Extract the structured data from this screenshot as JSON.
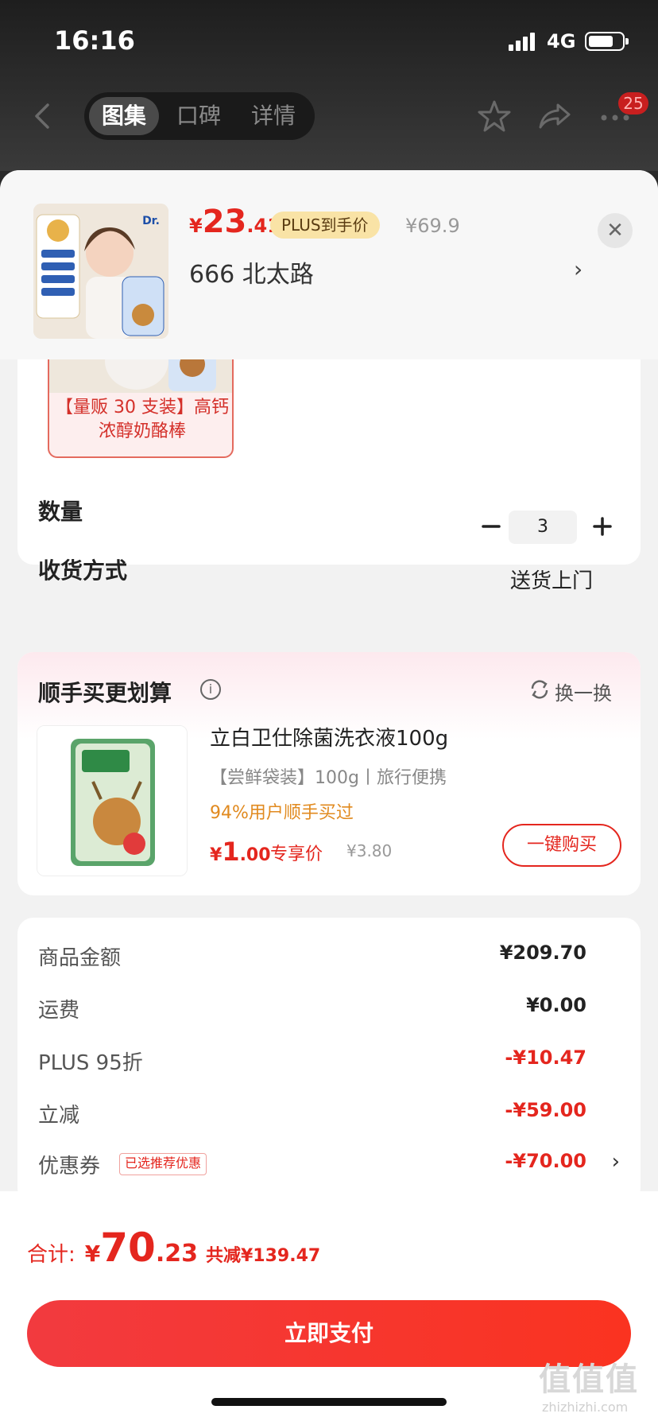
{
  "status": {
    "time": "16:16",
    "network": "4G"
  },
  "nav": {
    "tabs": [
      {
        "label": "图集",
        "active": true
      },
      {
        "label": "口碑",
        "active": false
      },
      {
        "label": "详情",
        "active": false
      }
    ],
    "badge": "25"
  },
  "header": {
    "price_currency": "¥",
    "price_int": "23",
    "price_dec": ".41",
    "plus_tag": "PLUS到手价",
    "orig_price": "¥69.9",
    "address": "666  北太路",
    "close_icon": "close-icon"
  },
  "product": {
    "sku_label": "【量贩 30 支装】高钙浓醇奶酪棒",
    "qty_label": "数量",
    "qty_value": "3",
    "delivery_label": "收货方式",
    "delivery_value": "送货上门"
  },
  "addon": {
    "title": "顺手买更划算",
    "swap_label": "换一换",
    "name": "立白卫仕除菌洗衣液100g",
    "subtitle": "【尝鲜袋装】100g丨旅行便携",
    "stat": "94%用户顺手买过",
    "price_currency": "¥",
    "price_int": "1",
    "price_dec": ".00",
    "price_tag": "专享价",
    "orig_price": "¥3.80",
    "buy_label": "一键购买"
  },
  "summary": {
    "rows": [
      {
        "label": "商品金额",
        "value": "¥209.70"
      },
      {
        "label": "运费",
        "value": "¥0.00"
      },
      {
        "label": "PLUS 95折",
        "value": "-¥10.47"
      },
      {
        "label": "立减",
        "value": "-¥59.00"
      },
      {
        "label": "优惠券",
        "value": "-¥70.00",
        "tag": "已选推荐优惠"
      }
    ]
  },
  "footer": {
    "total_label": "合计:",
    "total_currency": "¥",
    "total_int": "70",
    "total_dec": ".23",
    "total_save": "共减¥139.47",
    "pay_label": "立即支付"
  },
  "watermark": {
    "text": "值值值",
    "sub": "zhizhizhi.com"
  },
  "colors": {
    "accent": "#e4261e",
    "plus_gold": "#f9e3a6",
    "orange": "#e18a1f"
  }
}
